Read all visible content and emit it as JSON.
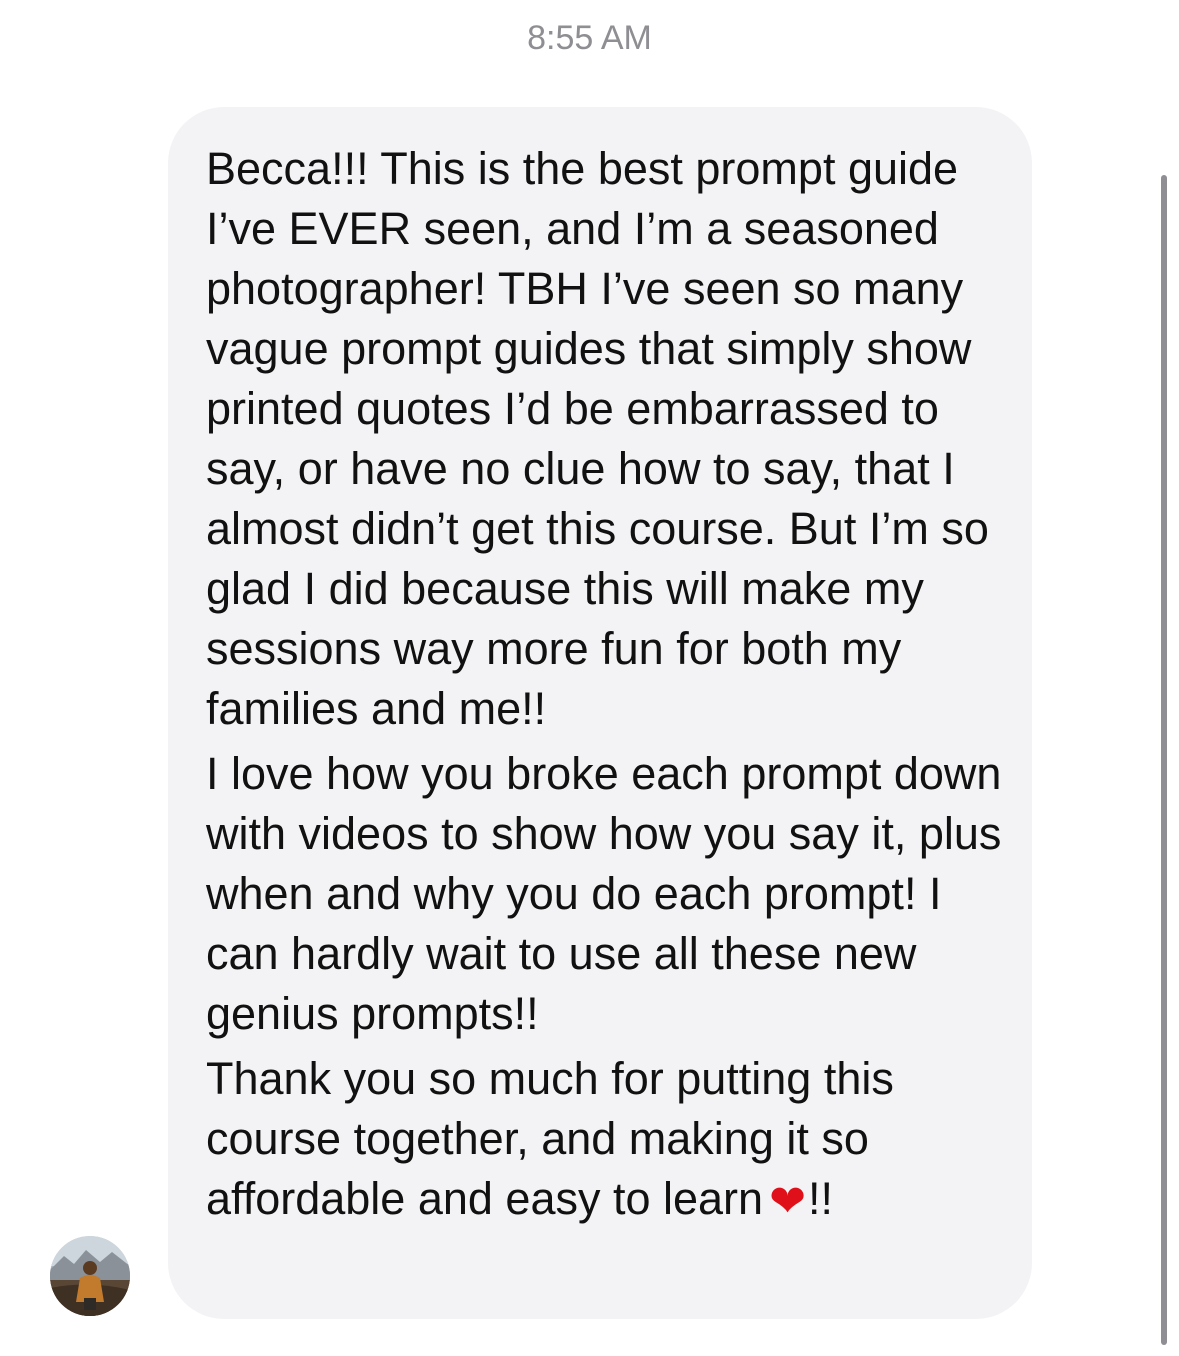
{
  "header": {
    "timestamp": "8:55 AM"
  },
  "message": {
    "paragraphs": [
      "Becca!!! This is the best prompt guide I’ve EVER seen, and I’m a seasoned photographer! TBH I’ve seen so many vague prompt guides that simply show printed quotes I’d be embarrassed to say, or have no clue how to say, that I almost didn’t get this course. But I’m so glad I did because this will make my sessions way more fun for both my families and me!!",
      "I love how you broke each prompt down with videos to show how you say it, plus when and why you do each prompt! I can hardly wait to use all these new genius prompts!!",
      "Thank you so much for putting this course together, and making it so affordable and easy to learn"
    ],
    "emoji": "❤",
    "suffix": "!!"
  },
  "colors": {
    "bubble": "#f3f3f5",
    "text": "#111111",
    "timestamp": "#8e8e93",
    "heart": "#e0101a"
  },
  "icons": {
    "avatar": "sender-avatar-photo",
    "emoji": "red-heart-emoji"
  }
}
